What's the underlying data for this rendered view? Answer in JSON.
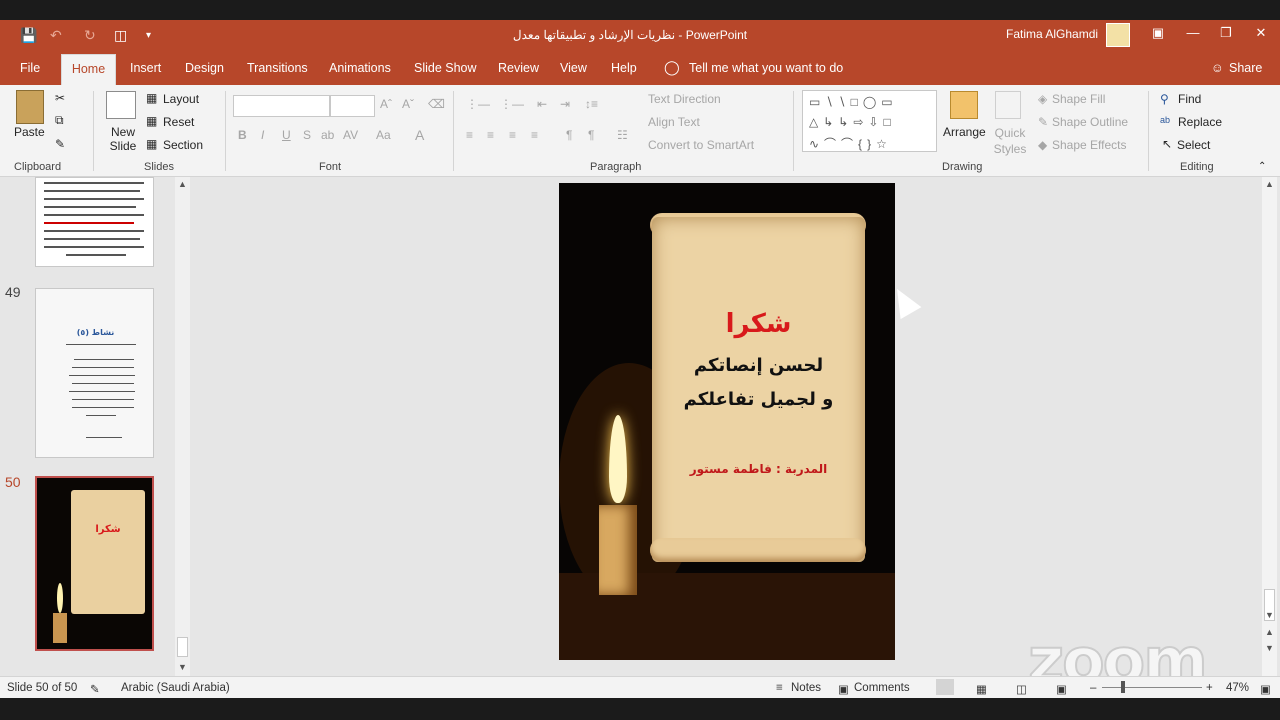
{
  "titlebar": {
    "document_title": "نظريات الإرشاد و تطبيقاتها معدل  -  PowerPoint",
    "user_name": "Fatima AlGhamdi"
  },
  "tabs": {
    "file": "File",
    "home": "Home",
    "insert": "Insert",
    "design": "Design",
    "transitions": "Transitions",
    "animations": "Animations",
    "slideshow": "Slide Show",
    "review": "Review",
    "view": "View",
    "help": "Help",
    "tellme": "Tell me what you want to do",
    "share": "Share"
  },
  "ribbon": {
    "clipboard": {
      "paste": "Paste",
      "group": "Clipboard"
    },
    "slides": {
      "new_slide": "New Slide",
      "layout": "Layout",
      "reset": "Reset",
      "section": "Section",
      "group": "Slides"
    },
    "font": {
      "group": "Font"
    },
    "paragraph": {
      "text_direction": "Text Direction",
      "align_text": "Align Text",
      "smartart": "Convert to SmartArt",
      "group": "Paragraph"
    },
    "drawing": {
      "arrange": "Arrange",
      "quick_styles": "Quick Styles",
      "shape_fill": "Shape Fill",
      "shape_outline": "Shape Outline",
      "shape_effects": "Shape Effects",
      "group": "Drawing"
    },
    "editing": {
      "find": "Find",
      "replace": "Replace",
      "select": "Select",
      "group": "Editing"
    }
  },
  "thumbnails": [
    {
      "number": "49",
      "title": "نشاط (٥)"
    },
    {
      "number": "50",
      "title": "شكرا"
    }
  ],
  "slide": {
    "heading": "شكرا",
    "line1": "لحسن إنصاتكم",
    "line2": "و لجميل تفاعلكم",
    "trainer": "المدربة : فاطمة مستور"
  },
  "statusbar": {
    "slide_counter": "Slide 50 of 50",
    "language": "Arabic (Saudi Arabia)",
    "notes": "Notes",
    "comments": "Comments",
    "zoom": "47%"
  },
  "overlay": {
    "zoom_logo": "zoom"
  },
  "colors": {
    "accent": "#b7472a",
    "slide_red": "#d8191b"
  }
}
